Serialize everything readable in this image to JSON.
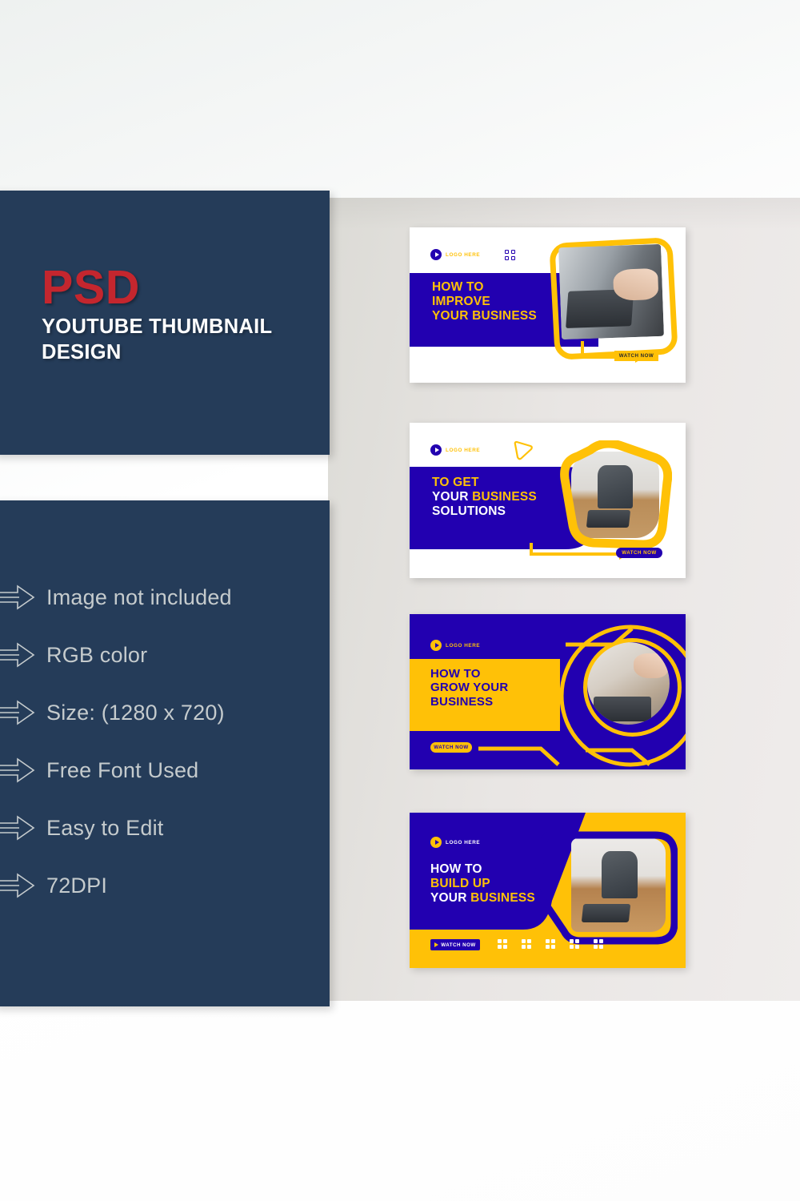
{
  "title_panel": {
    "brand": "PSD",
    "subtitle_line1": "YOUTUBE THUMBNAIL",
    "subtitle_line2": "DESIGN",
    "brand_color": "#c4262e",
    "panel_color": "#253c59"
  },
  "features": {
    "icon": "arrow-right-outline-icon",
    "items": [
      "Image not included",
      "RGB color",
      "Size: (1280 x 720)",
      "Free Font Used",
      "Easy to Edit",
      "72DPI"
    ]
  },
  "palette": {
    "blue": "#2200b0",
    "yellow": "#ffc107",
    "white": "#ffffff",
    "navy": "#253c59",
    "panel_gray": "#e9e6e4"
  },
  "thumbnails": [
    {
      "name": "improve-your-business",
      "logo_text": "LOGO HERE",
      "logo_icon": "play-circle-icon",
      "decor": "grid-dots-icon",
      "headline": [
        {
          "text": "HOW TO",
          "color": "yellow"
        },
        {
          "text": "IMPROVE",
          "color": "yellow"
        },
        {
          "text": "YOUR BUSINESS",
          "color": "yellow"
        }
      ],
      "cta": "WATCH NOW",
      "cta_style": "yellow-rect",
      "photo": "hands-on-laptop-photo"
    },
    {
      "name": "business-solutions",
      "logo_text": "LOGO HERE",
      "logo_icon": "play-circle-icon",
      "decor": "triangle-outline-icon",
      "headline": [
        {
          "text": "TO GET",
          "color": "yellow"
        },
        {
          "text": "YOUR ",
          "color": "white",
          "text2": "BUSINESS",
          "color2": "yellow"
        },
        {
          "text": "SOLUTIONS",
          "color": "white"
        }
      ],
      "cta": "WATCH NOW",
      "cta_style": "blue-pill",
      "photo": "man-at-desk-photo"
    },
    {
      "name": "grow-your-business",
      "logo_text": "LOGO HERE",
      "logo_icon": "play-circle-icon",
      "decor": "circuit-lines",
      "headline": [
        {
          "text": "HOW TO",
          "color": "blue"
        },
        {
          "text": "GROW YOUR",
          "color": "blue"
        },
        {
          "text": "BUSINESS",
          "color": "blue"
        }
      ],
      "cta": "WATCH NOW",
      "cta_style": "yellow-pill",
      "photo": "team-meeting-photo"
    },
    {
      "name": "build-up-your-business",
      "logo_text": "LOGO HERE",
      "logo_icon": "play-circle-icon",
      "decor": "white-dot-groups",
      "headline": [
        {
          "text": "HOW TO",
          "color": "white"
        },
        {
          "text": "BUILD UP",
          "color": "yellow"
        },
        {
          "text": "YOUR ",
          "color": "white",
          "text2": "BUSINESS",
          "color2": "yellow"
        }
      ],
      "cta": "WATCH NOW",
      "cta_style": "blue-rect",
      "photo": "man-working-photo"
    }
  ]
}
